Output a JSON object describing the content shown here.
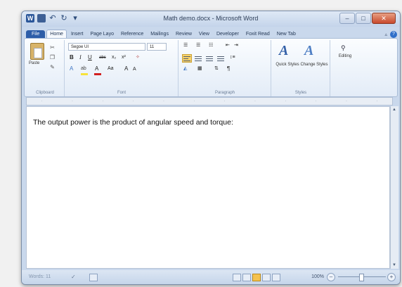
{
  "window": {
    "title": "Math demo.docx - Microsoft Word"
  },
  "tabs": [
    {
      "label": "File"
    },
    {
      "label": "Home"
    },
    {
      "label": "Insert"
    },
    {
      "label": "Page Layo"
    },
    {
      "label": "Reference"
    },
    {
      "label": "Mailings"
    },
    {
      "label": "Review"
    },
    {
      "label": "View"
    },
    {
      "label": "Developer"
    },
    {
      "label": "Foxit Read"
    },
    {
      "label": "New Tab"
    }
  ],
  "ribbon": {
    "clipboard": {
      "paste_label": "Paste",
      "group_label": "Clipboard"
    },
    "font": {
      "font_name": "Segoe UI",
      "font_size": "11",
      "group_label": "Font"
    },
    "paragraph": {
      "group_label": "Paragraph"
    },
    "styles": {
      "quick_styles_label": "Quick Styles",
      "change_styles_label": "Change Styles",
      "group_label": "Styles"
    },
    "editing": {
      "label": "Editing"
    }
  },
  "document": {
    "text": "The output power is the product of angular speed and torque:"
  },
  "statusbar": {
    "words": "Words: 11",
    "zoom": "100%",
    "zoom_level_percent": 100
  },
  "colors": {
    "file_tab": "#2e5ea8",
    "selected_view": "#f5c24e"
  }
}
